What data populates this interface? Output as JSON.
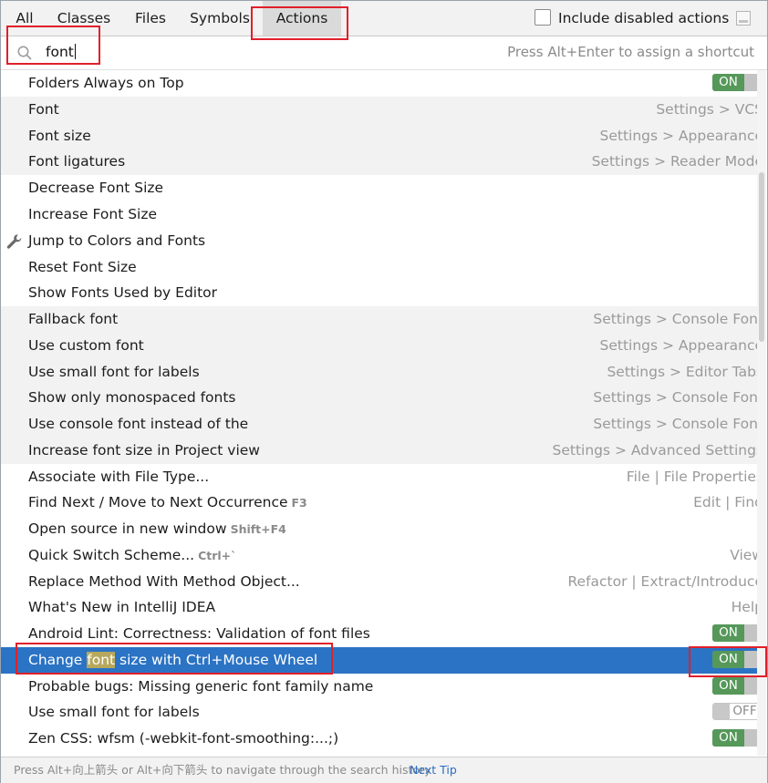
{
  "tabs": [
    {
      "label": "All",
      "active": false
    },
    {
      "label": "Classes",
      "active": false
    },
    {
      "label": "Files",
      "active": false
    },
    {
      "label": "Symbols",
      "active": false
    },
    {
      "label": "Actions",
      "active": true
    }
  ],
  "include_disabled": {
    "label": "Include disabled actions",
    "checked": false
  },
  "search": {
    "value": "font",
    "hint": "Press Alt+Enter to assign a shortcut"
  },
  "results": [
    {
      "name": "Folders Always on Top",
      "toggle": "ON"
    },
    {
      "name": "Font",
      "location": "Settings > VCS"
    },
    {
      "name": "Font size",
      "location": "Settings > Appearance"
    },
    {
      "name": "Font ligatures",
      "location": "Settings > Reader Mode"
    },
    {
      "name": "Decrease Font Size"
    },
    {
      "name": "Increase Font Size"
    },
    {
      "name": "Jump to Colors and Fonts",
      "icon": "wrench-icon"
    },
    {
      "name": "Reset Font Size"
    },
    {
      "name": "Show Fonts Used by Editor"
    },
    {
      "name": "Fallback font",
      "location": "Settings > Console Font"
    },
    {
      "name": "Use custom font",
      "location": "Settings > Appearance"
    },
    {
      "name": "Use small font for labels",
      "location": "Settings > Editor Tabs"
    },
    {
      "name": "Show only monospaced fonts",
      "location": "Settings > Console Font"
    },
    {
      "name": "Use console font instead of the",
      "location": "Settings > Console Font"
    },
    {
      "name": "Increase font size in Project view",
      "location": "Settings > Advanced Settings"
    },
    {
      "name": "Associate with File Type...",
      "location": "File | File Properties"
    },
    {
      "name": "Find Next / Move to Next Occurrence",
      "shortcut": "F3",
      "location": "Edit | Find"
    },
    {
      "name": "Open source in new window",
      "shortcut": "Shift+F4"
    },
    {
      "name": "Quick Switch Scheme...",
      "shortcut": "Ctrl+`",
      "location": "View"
    },
    {
      "name": "Replace Method With Method Object...",
      "location": "Refactor | Extract/Introduce"
    },
    {
      "name": "What's New in IntelliJ IDEA",
      "location": "Help"
    },
    {
      "name": "Android Lint: Correctness: Validation of font files",
      "toggle": "ON"
    },
    {
      "name_before": "Change ",
      "name_highlight": "font",
      "name_after": " size with Ctrl+Mouse Wheel",
      "toggle": "ON",
      "selected": true
    },
    {
      "name": "Probable bugs: Missing generic font family name",
      "toggle": "ON"
    },
    {
      "name": "Use small font for labels",
      "toggle": "OFF"
    },
    {
      "name": "Zen CSS: wfsm (-webkit-font-smoothing:...;)",
      "toggle": "ON"
    }
  ],
  "footer": {
    "tip": "Press Alt+向上箭头 or Alt+向下箭头 to navigate through the search history",
    "next_tip": "Next Tip"
  },
  "colors": {
    "selection": "#2b73c4",
    "toggle_on": "#55985a",
    "annotation": "#e0202a",
    "link": "#2b6cc2"
  }
}
